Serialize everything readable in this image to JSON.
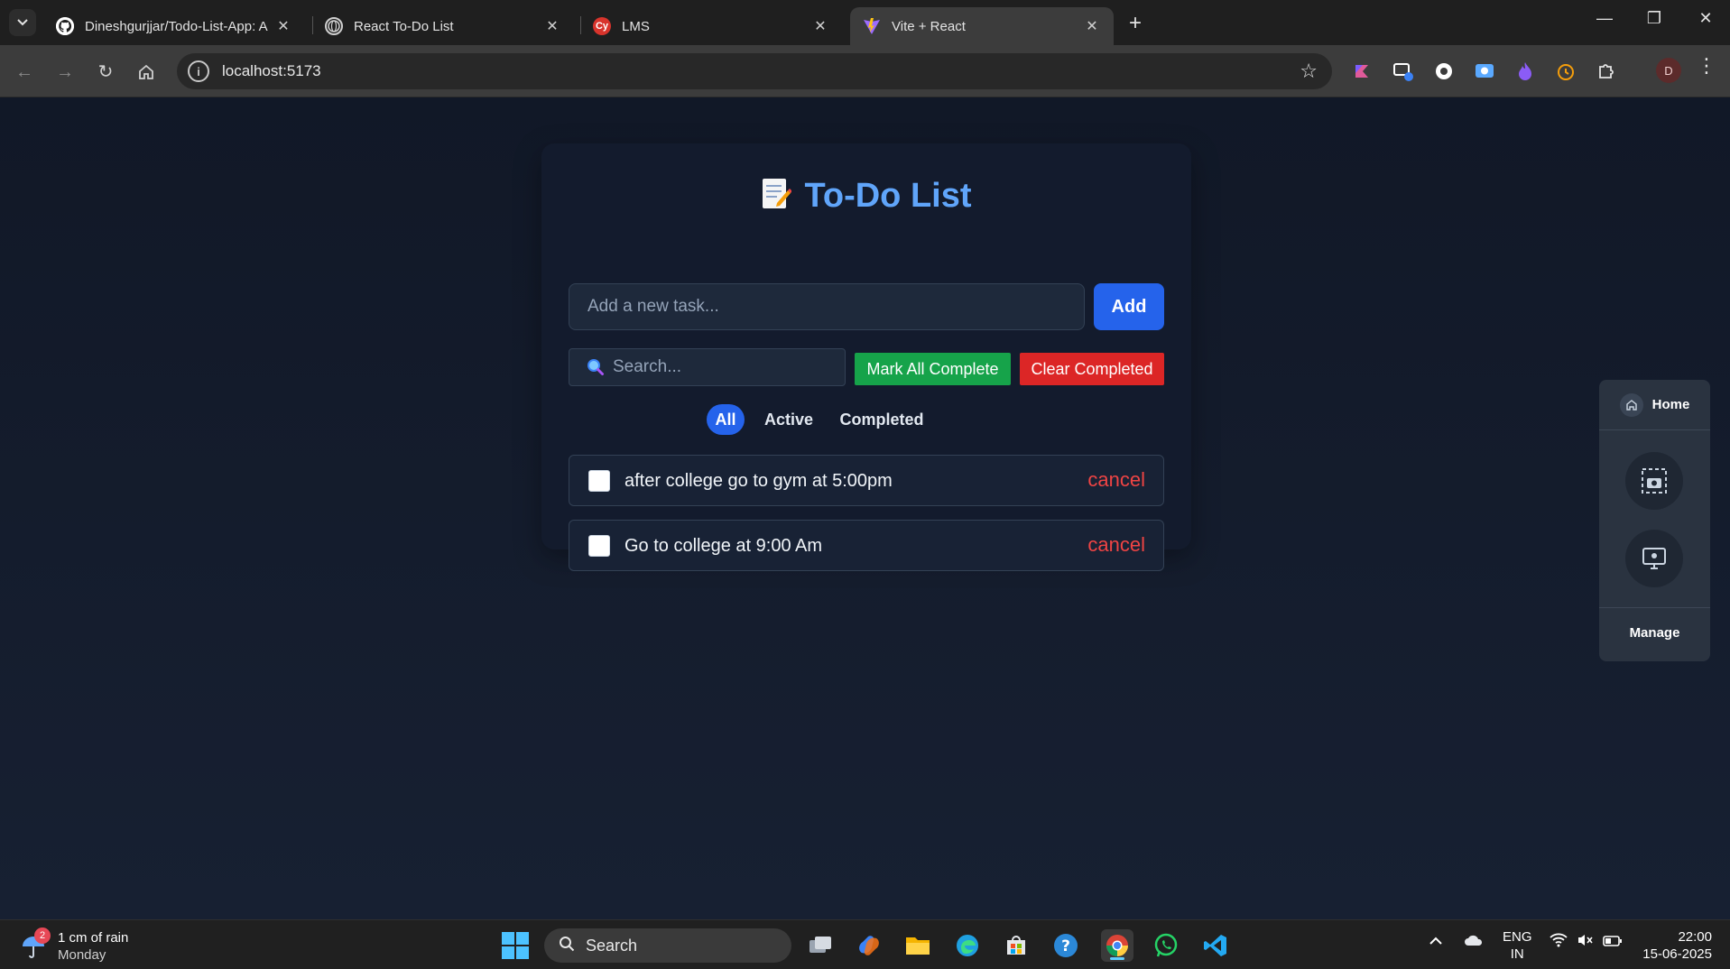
{
  "browser": {
    "tabs": [
      {
        "title": "Dineshgurjjar/Todo-List-App: A",
        "favicon": "github-icon",
        "active": false
      },
      {
        "title": "React To-Do List",
        "favicon": "globe-icon",
        "active": false
      },
      {
        "title": "LMS",
        "favicon": "lms-icon",
        "active": false
      },
      {
        "title": "Vite + React",
        "favicon": "vite-icon",
        "active": true
      }
    ],
    "new_tab": "+",
    "url": "localhost:5173",
    "profile_initial": "D"
  },
  "app": {
    "title": "To-Do List",
    "title_icon": "memo-icon",
    "new_task_placeholder": "Add a new task...",
    "new_task_value": "",
    "add_label": "Add",
    "search_placeholder": "Search...",
    "mark_all_label": "Mark All Complete",
    "clear_completed_label": "Clear Completed",
    "filters": [
      {
        "label": "All",
        "selected": true
      },
      {
        "label": "Active",
        "selected": false
      },
      {
        "label": "Completed",
        "selected": false
      }
    ],
    "todos": [
      {
        "text": "after college go to gym at 5:00pm",
        "done": false,
        "action": "cancel"
      },
      {
        "text": "Go to college at 9:00 Am",
        "done": false,
        "action": "cancel"
      }
    ],
    "colors": {
      "title": "#60a5fa",
      "primary": "#2563eb",
      "success": "#16a34a",
      "danger": "#dc2626",
      "cancel_text": "#ef4444"
    }
  },
  "side_panel": {
    "home_label": "Home",
    "manage_label": "Manage"
  },
  "taskbar": {
    "weather_text": "1 cm of rain",
    "weather_day": "Monday",
    "weather_badge": "2",
    "search_label": "Search",
    "lang_line1": "ENG",
    "lang_line2": "IN",
    "time": "22:00",
    "date": "15-06-2025"
  }
}
